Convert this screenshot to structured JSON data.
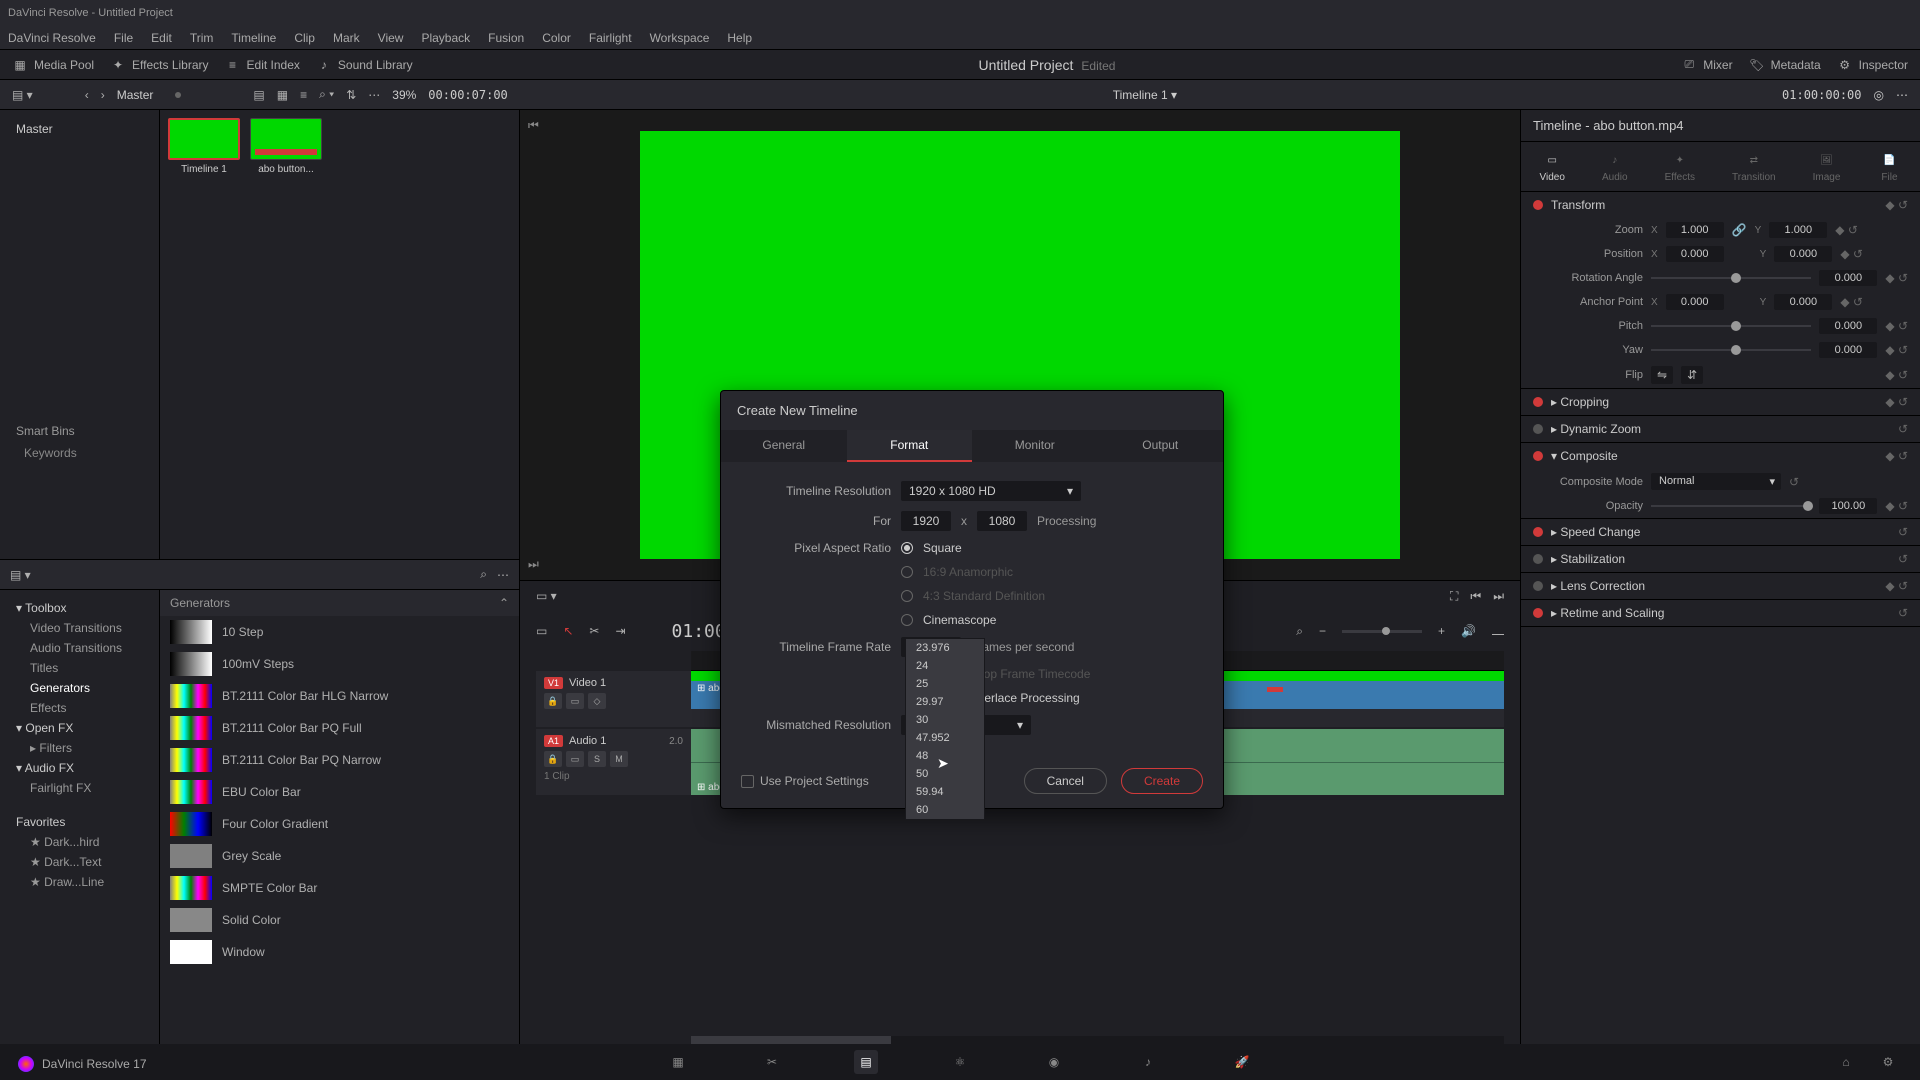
{
  "titlebar": "DaVinci Resolve - Untitled Project",
  "menu": [
    "DaVinci Resolve",
    "File",
    "Edit",
    "Trim",
    "Timeline",
    "Clip",
    "Mark",
    "View",
    "Playback",
    "Fusion",
    "Color",
    "Fairlight",
    "Workspace",
    "Help"
  ],
  "toolbar": {
    "mediaPool": "Media Pool",
    "effectsLibrary": "Effects Library",
    "editIndex": "Edit Index",
    "soundLibrary": "Sound Library",
    "mixer": "Mixer",
    "metadata": "Metadata",
    "inspector": "Inspector"
  },
  "project": {
    "name": "Untitled Project",
    "edited": "Edited"
  },
  "subheader": {
    "master": "Master",
    "zoom": "39%",
    "tc_left": "00:00:07:00",
    "timeline_name": "Timeline 1",
    "tc_right": "01:00:00:00"
  },
  "mediaPool": {
    "master": "Master",
    "smartBins": "Smart Bins",
    "keywords": "Keywords",
    "thumbs": [
      {
        "label": "Timeline 1"
      },
      {
        "label": "abo button..."
      }
    ]
  },
  "effects": {
    "groups": {
      "toolbox": "Toolbox",
      "videoTransitions": "Video Transitions",
      "audioTransitions": "Audio Transitions",
      "titles": "Titles",
      "generators": "Generators",
      "effectsItem": "Effects",
      "openFX": "Open FX",
      "filters": "Filters",
      "audioFX": "Audio FX",
      "fairlightFX": "Fairlight FX",
      "favorites": "Favorites",
      "fav1": "Dark...hird",
      "fav2": "Dark...Text",
      "fav3": "Draw...Line"
    },
    "listHeader": "Generators",
    "items": [
      {
        "name": "10 Step",
        "cls": ""
      },
      {
        "name": "100mV Steps",
        "cls": ""
      },
      {
        "name": "BT.2111 Color Bar HLG Narrow",
        "cls": "bars"
      },
      {
        "name": "BT.2111 Color Bar PQ Full",
        "cls": "bars"
      },
      {
        "name": "BT.2111 Color Bar PQ Narrow",
        "cls": "bars"
      },
      {
        "name": "EBU Color Bar",
        "cls": "bars"
      },
      {
        "name": "Four Color Gradient",
        "cls": "grad"
      },
      {
        "name": "Grey Scale",
        "cls": "grey"
      },
      {
        "name": "SMPTE Color Bar",
        "cls": "bars"
      },
      {
        "name": "Solid Color",
        "cls": "solid"
      },
      {
        "name": "Window",
        "cls": "win"
      }
    ]
  },
  "timeline": {
    "tc": "01:00:00:00",
    "v1badge": "V1",
    "v1name": "Video 1",
    "a1badge": "A1",
    "a1name": "Audio 1",
    "a1ch": "2.0",
    "clip": "abo button.mp4",
    "clipCount": "1 Clip"
  },
  "inspector": {
    "title": "Timeline - abo button.mp4",
    "tabs": [
      "Video",
      "Audio",
      "Effects",
      "Transition",
      "Image",
      "File"
    ],
    "sections": {
      "transform": "Transform",
      "cropping": "Cropping",
      "dynamicZoom": "Dynamic Zoom",
      "composite": "Composite",
      "speedChange": "Speed Change",
      "stabilization": "Stabilization",
      "lensCorrection": "Lens Correction",
      "retime": "Retime and Scaling"
    },
    "transform": {
      "zoom": "Zoom",
      "zoomX": "1.000",
      "zoomY": "1.000",
      "position": "Position",
      "posX": "0.000",
      "posY": "0.000",
      "rotation": "Rotation Angle",
      "rotVal": "0.000",
      "anchor": "Anchor Point",
      "anchX": "0.000",
      "anchY": "0.000",
      "pitch": "Pitch",
      "pitchVal": "0.000",
      "yaw": "Yaw",
      "yawVal": "0.000",
      "flip": "Flip"
    },
    "composite": {
      "mode": "Composite Mode",
      "modeVal": "Normal",
      "opacity": "Opacity",
      "opacityVal": "100.00"
    }
  },
  "dialog": {
    "title": "Create New Timeline",
    "tabs": [
      "General",
      "Format",
      "Monitor",
      "Output"
    ],
    "timelineRes": "Timeline Resolution",
    "timelineResVal": "1920 x 1080 HD",
    "for": "For",
    "w": "1920",
    "h": "1080",
    "processing": "Processing",
    "par": "Pixel Aspect Ratio",
    "parOpts": [
      "Square",
      "16:9 Anamorphic",
      "4:3 Standard Definition",
      "Cinemascope"
    ],
    "frameRate": "Timeline Frame Rate",
    "frameRateVal": "60",
    "fps": "Frames per second",
    "dropFrame": "Drop Frame Timecode",
    "interlace": "Interlace Processing",
    "mismatched": "Mismatched Resolution",
    "mismatchedVal": "image to fit",
    "useProject": "Use Project Settings",
    "cancel": "Cancel",
    "create": "Create",
    "frameRateOptions": [
      "23.976",
      "24",
      "25",
      "29.97",
      "30",
      "47.952",
      "48",
      "50",
      "59.94",
      "60"
    ]
  },
  "appName": "DaVinci Resolve 17"
}
